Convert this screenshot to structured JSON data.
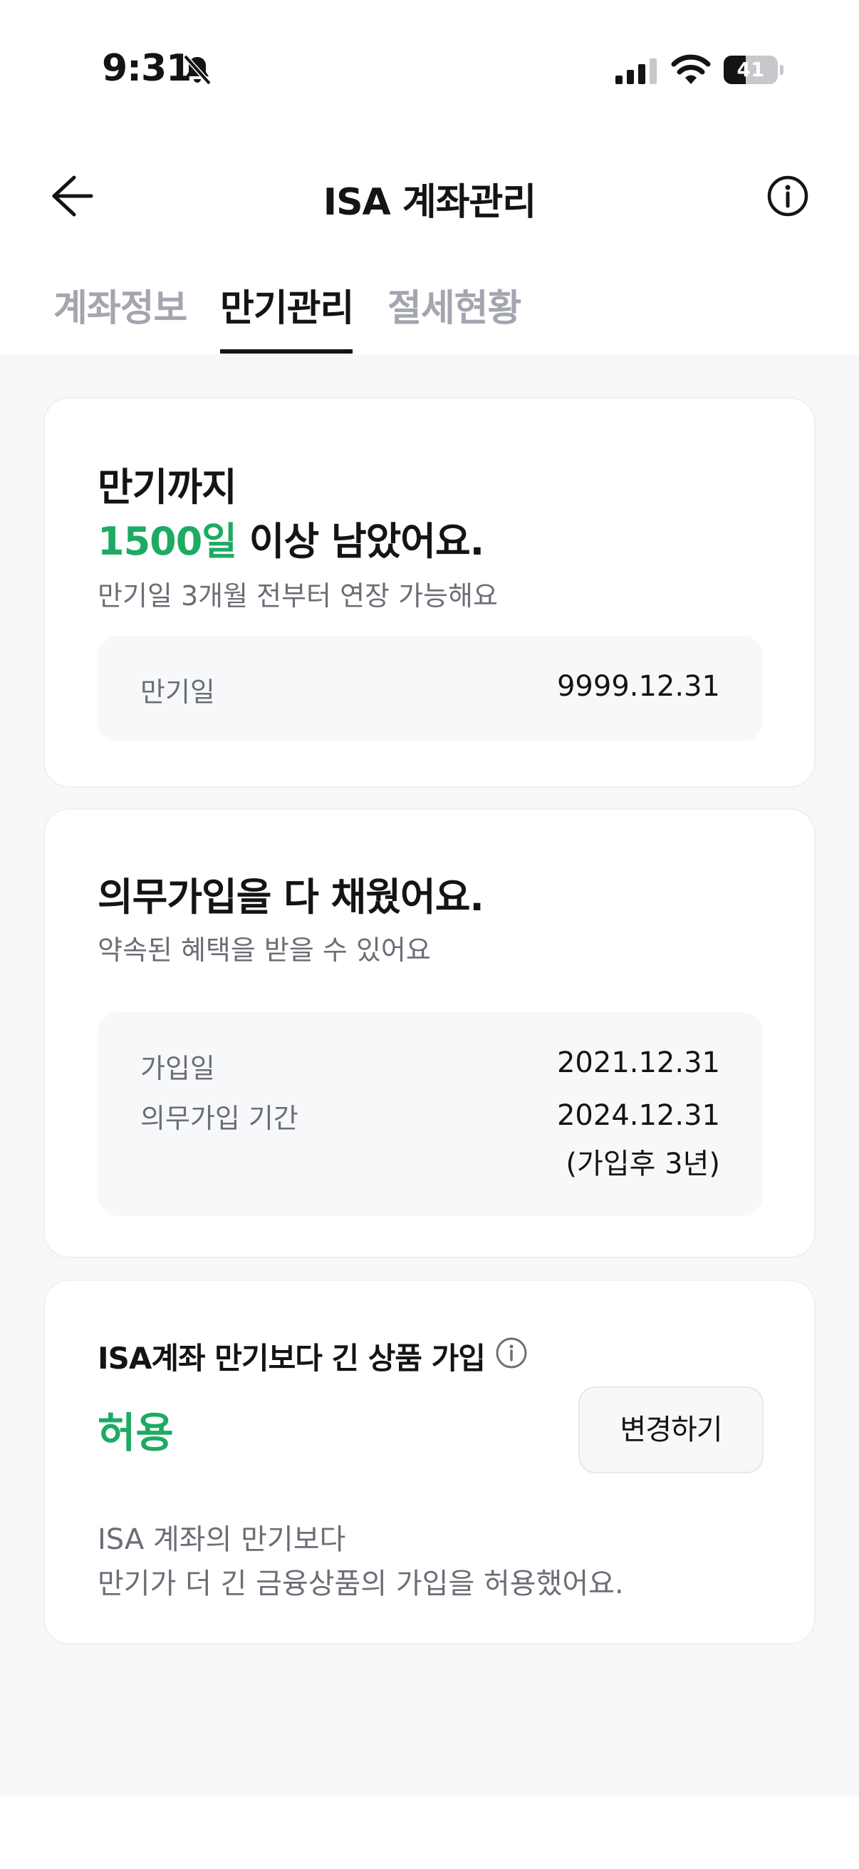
{
  "status_bar": {
    "time": "9:31",
    "battery": "41",
    "battery_level": 0.41
  },
  "header": {
    "title": "ISA 계좌관리"
  },
  "tabs": [
    {
      "label": "계좌정보",
      "active": false
    },
    {
      "label": "만기관리",
      "active": true
    },
    {
      "label": "절세현황",
      "active": false
    }
  ],
  "maturity_card": {
    "line1": "만기까지",
    "days_highlight": "1500일",
    "line2_rest": " 이상 남았어요.",
    "subtitle": "만기일 3개월 전부터 연장 가능해요",
    "maturity_date_label": "만기일",
    "maturity_date_value": "9999.12.31"
  },
  "obligation_card": {
    "title": "의무가입을 다 채웠어요.",
    "subtitle": "약속된 혜택을 받을 수 있어요",
    "join_date_label": "가입일",
    "join_date_value": "2021.12.31",
    "period_label": "의무가입 기간",
    "period_value": "2024.12.31",
    "period_note": "(가입후 3년)"
  },
  "longer_product_card": {
    "title": "ISA계좌 만기보다 긴 상품 가입",
    "status": "허용",
    "change_button": "변경하기",
    "desc_line1": "ISA 계좌의 만기보다",
    "desc_line2": "만기가 더 긴 금융상품의 가입을 허용했어요."
  },
  "colors": {
    "accent_green": "#1eaa62",
    "text": "#141414",
    "muted": "#6b6e76",
    "background": "#f7f8fa"
  }
}
